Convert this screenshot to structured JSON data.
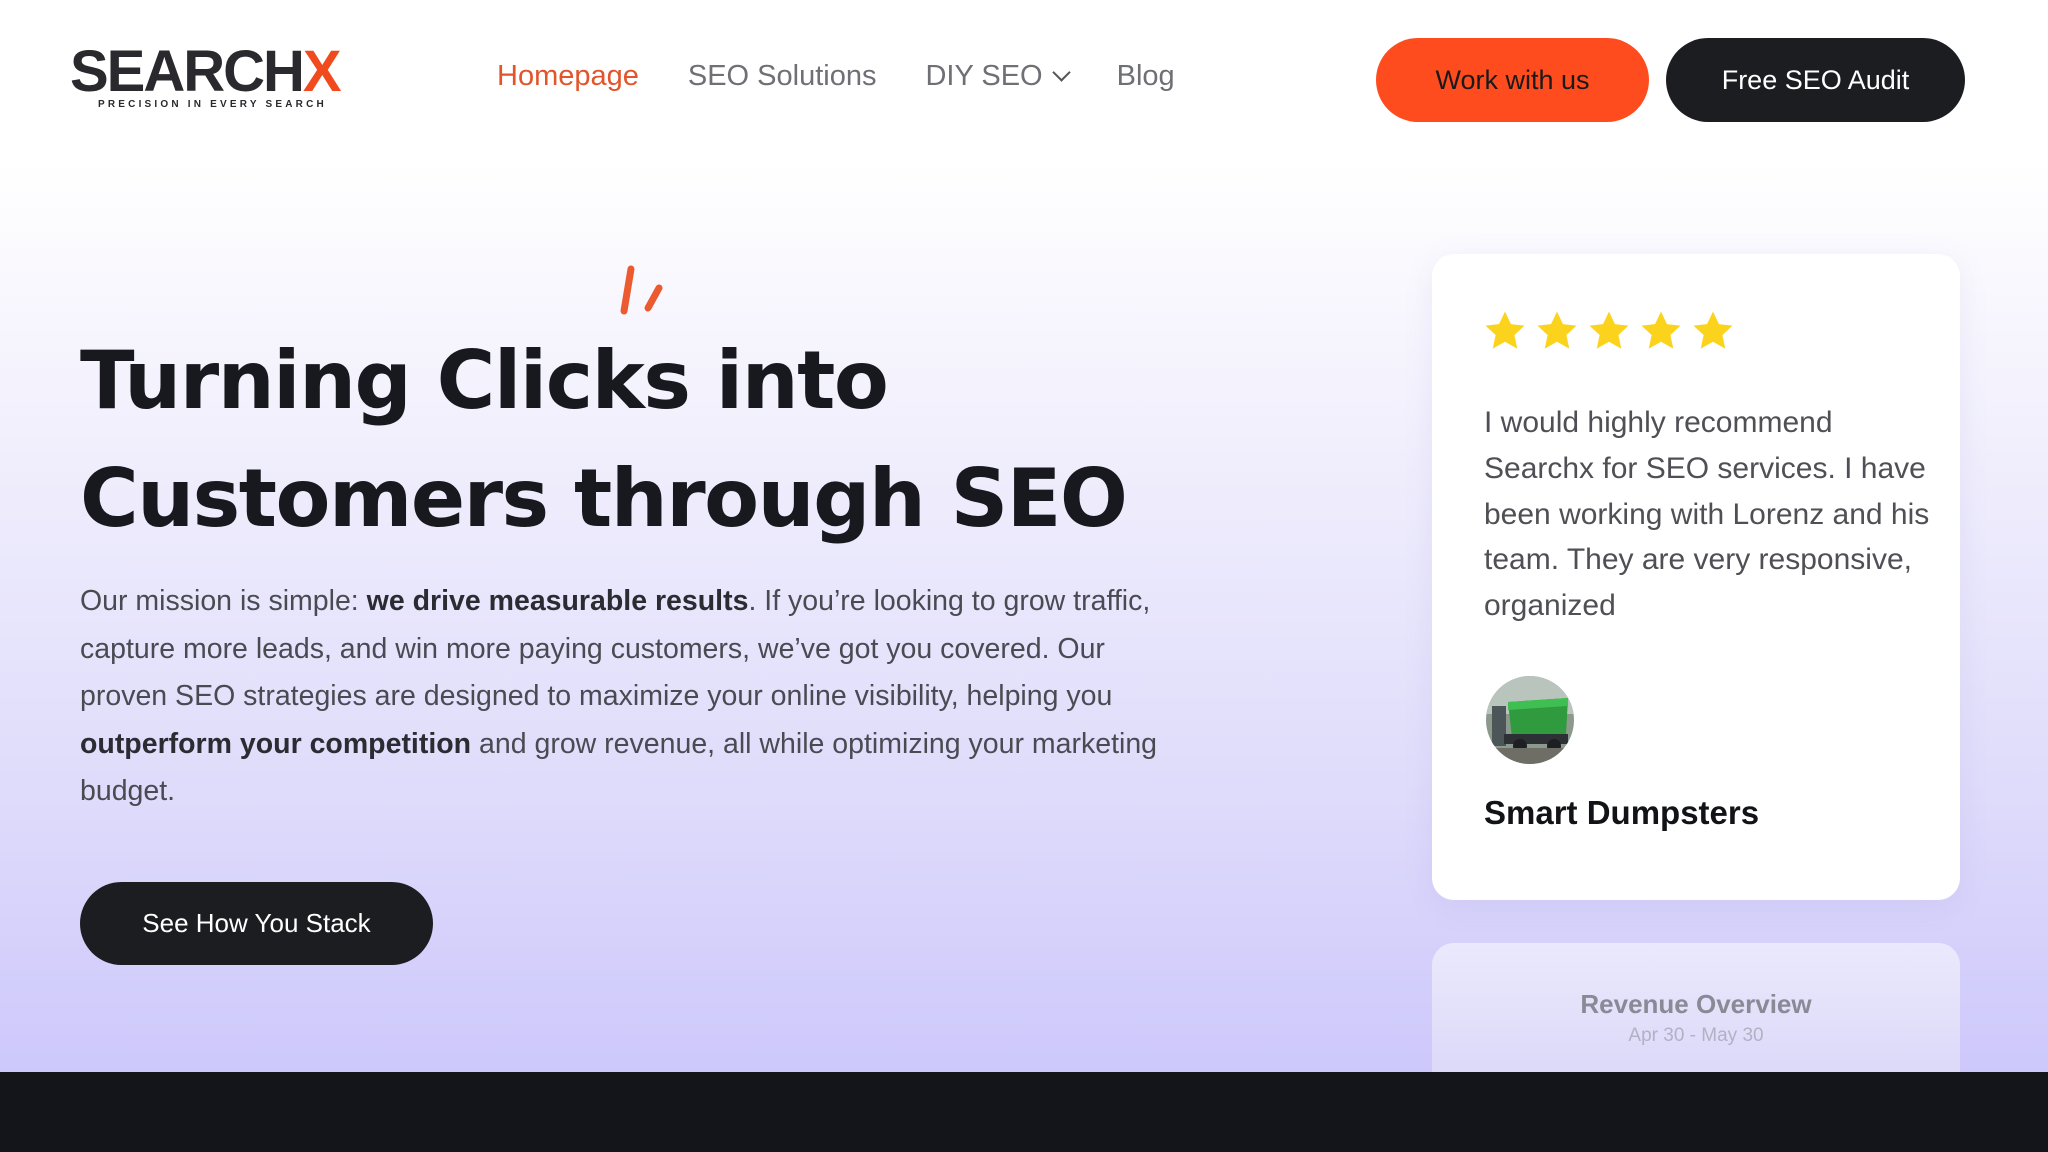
{
  "brand": {
    "logo_text": "SEARCH",
    "logo_x": "X",
    "tagline": "PRECISION IN EVERY SEARCH",
    "accent_color": "#ff4c1e",
    "dark_color": "#1c1d21"
  },
  "nav": {
    "items": [
      {
        "label": "Homepage",
        "active": true
      },
      {
        "label": "SEO Solutions",
        "active": false
      },
      {
        "label": "DIY SEO",
        "active": false,
        "icon": "chevron-down-icon"
      },
      {
        "label": "Blog",
        "active": false
      }
    ]
  },
  "header": {
    "work_button": "Work with us",
    "audit_button": "Free SEO Audit"
  },
  "hero": {
    "title_line1": "Turning Clicks into",
    "title_line2": "Customers through SEO",
    "desc_1": "Our mission is simple: ",
    "desc_bold_1": "we drive measurable results",
    "desc_2": ". If you’re looking to grow traffic, capture more leads, and win more paying customers, we’ve got you covered. Our proven SEO strategies are designed to maximize your online visibility, helping you ",
    "desc_bold_2": "outperform your competition",
    "desc_3": " and grow revenue, all while optimizing your marketing budget.",
    "cta": "See How You Stack"
  },
  "testimonial": {
    "rating": 5,
    "star_color": "#fbd31d",
    "quote": "I would highly recommend Searchx for SEO services. I have been working with Lorenz and his team. They are very responsive, organized",
    "author": "Smart Dumpsters"
  },
  "revenue_card": {
    "title": "Revenue Overview",
    "date_range": "Apr 30 - May 30"
  }
}
